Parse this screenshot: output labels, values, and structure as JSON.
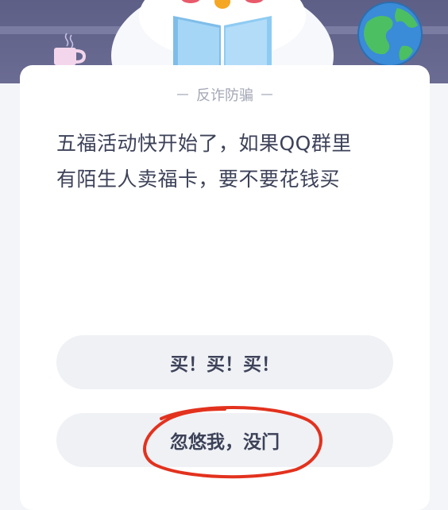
{
  "card": {
    "tag": "反诈防骗",
    "question_line1": "五福活动快开始了，如果QQ群里",
    "question_line2": "有陌生人卖福卡，要不要花钱买"
  },
  "options": [
    {
      "label": "买！买！买！"
    },
    {
      "label": "忽悠我，没门"
    }
  ],
  "colors": {
    "banner": "#5d5f86",
    "card": "#ffffff",
    "option_bg": "#eff1f5",
    "text": "#3d4259",
    "annotation": "#e2321e"
  },
  "icons": [
    "mug-icon",
    "mascot-illustration",
    "globe-icon"
  ]
}
